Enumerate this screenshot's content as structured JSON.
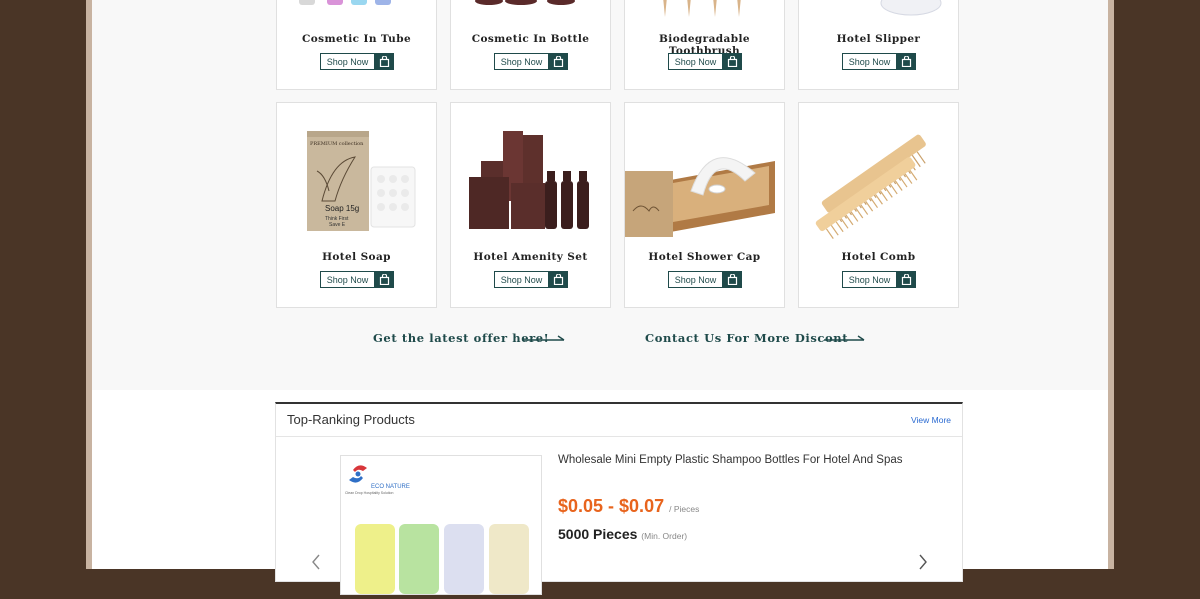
{
  "products_grid": {
    "cards": [
      {
        "name": "Cosmetic In Tube",
        "shop_label": "Shop Now"
      },
      {
        "name": "Cosmetic In Bottle",
        "shop_label": "Shop Now"
      },
      {
        "name": "Biodegradable Toothbrush",
        "shop_label": "Shop Now"
      },
      {
        "name": "Hotel Slipper",
        "shop_label": "Shop Now"
      },
      {
        "name": "Hotel Soap",
        "shop_label": "Shop Now"
      },
      {
        "name": "Hotel Amenity Set",
        "shop_label": "Shop Now"
      },
      {
        "name": "Hotel Shower Cap",
        "shop_label": "Shop Now"
      },
      {
        "name": "Hotel Comb",
        "shop_label": "Shop Now"
      }
    ]
  },
  "soap_pack": {
    "brand": "PREMIUM collection",
    "weight": "Soap 15g",
    "tagline1": "Think First",
    "tagline2": "Save E"
  },
  "links": {
    "latest_offer": "Get the latest offer here!",
    "contact": "Contact Us For More Discont"
  },
  "ranking": {
    "title": "Top-Ranking Products",
    "view_more": "View More",
    "product": {
      "brand": "ECO NATURE",
      "brand_sub": "Clean Drop Hospitality Solution",
      "name": "Wholesale Mini Empty Plastic Shampoo Bottles For Hotel And Spas",
      "price": "$0.05 - $0.07",
      "price_unit": "/ Pieces",
      "moq": "5000 Pieces",
      "moq_unit": "(Min. Order)"
    }
  },
  "colors": {
    "accent": "#1f4a4a",
    "price": "#e8641d",
    "link": "#2a6ad1",
    "frame": "#4a3526"
  }
}
